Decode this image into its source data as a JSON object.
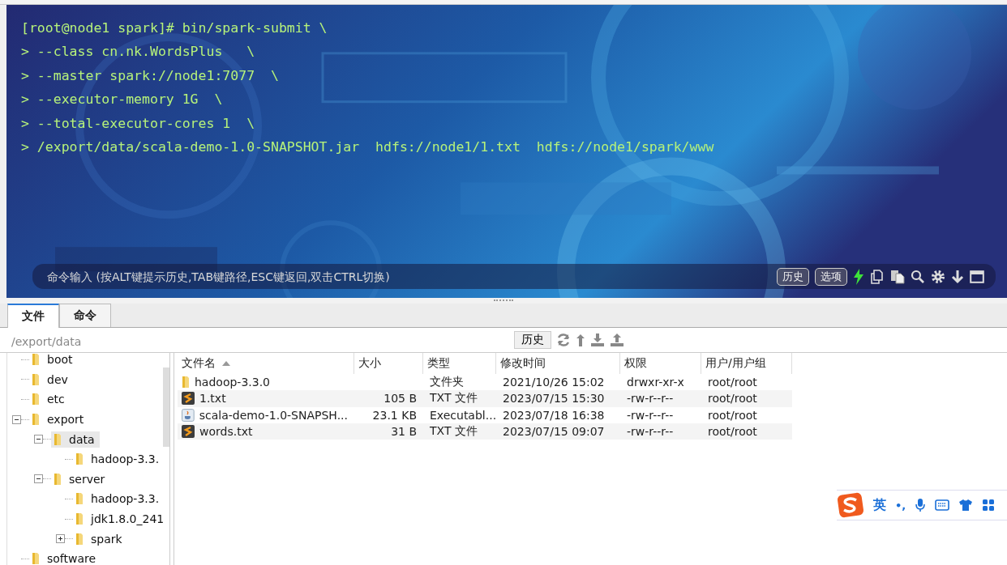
{
  "terminal": {
    "lines": [
      "[root@node1 spark]# bin/spark-submit \\",
      "> --class cn.nk.WordsPlus   \\",
      "> --master spark://node1:7077  \\",
      "> --executor-memory 1G  \\",
      "> --total-executor-cores 1  \\",
      "> /export/data/scala-demo-1.0-SNAPSHOT.jar  hdfs://node1/1.txt  hdfs://node1/spark/www"
    ],
    "command_input": {
      "placeholder": "命令输入 (按ALT键提示历史,TAB键路径,ESC键返回,双击CTRL切换)"
    },
    "buttons": [
      "历史",
      "选项"
    ]
  },
  "tabs": [
    {
      "label": "文件",
      "selected": true
    },
    {
      "label": "命令",
      "selected": false
    }
  ],
  "path_bar": {
    "path": "/export/data",
    "history_button": "历史"
  },
  "tree": [
    {
      "name": "boot",
      "selected": false
    },
    {
      "name": "dev",
      "selected": false
    },
    {
      "name": "etc",
      "selected": false
    },
    {
      "name": "export",
      "selected": false,
      "expanded": true,
      "children": [
        {
          "name": "data",
          "selected": true,
          "expanded": true,
          "children": [
            {
              "name": "hadoop-3.3.",
              "selected": false
            }
          ]
        },
        {
          "name": "server",
          "selected": false,
          "expanded": true,
          "children": [
            {
              "name": "hadoop-3.3.",
              "selected": false
            },
            {
              "name": "jdk1.8.0_241",
              "selected": false
            },
            {
              "name": "spark",
              "selected": false,
              "expanded": false
            }
          ]
        }
      ]
    },
    {
      "name": "software",
      "selected": false
    }
  ],
  "file_table": {
    "columns": [
      {
        "label": "文件名",
        "sorted": true
      },
      {
        "label": "大小",
        "sorted": false
      },
      {
        "label": "类型",
        "sorted": false
      },
      {
        "label": "修改时间",
        "sorted": false
      },
      {
        "label": "权限",
        "sorted": false
      },
      {
        "label": "用户/用户组",
        "sorted": false
      }
    ],
    "rows": [
      {
        "kind": "folder",
        "name": "hadoop-3.3.0",
        "type": "文件夹",
        "modified": "2021/10/26 15:02",
        "permissions": "drwxr-xr-x",
        "owner": "root/root"
      },
      {
        "kind": "text",
        "name": "1.txt",
        "size": "105 B",
        "type": "TXT 文件",
        "modified": "2023/07/15 15:30",
        "permissions": "-rw-r--r--",
        "owner": "root/root"
      },
      {
        "kind": "jar",
        "name": "scala-demo-1.0-SNAPSH...",
        "size": "23.1 KB",
        "type": "Executabl...",
        "modified": "2023/07/18 16:38",
        "permissions": "-rw-r--r--",
        "owner": "root/root"
      },
      {
        "kind": "text",
        "name": "words.txt",
        "size": "31 B",
        "type": "TXT 文件",
        "modified": "2023/07/15 09:07",
        "permissions": "-rw-r--r--",
        "owner": "root/root"
      }
    ]
  },
  "ime_toolbar": {
    "language": "英",
    "punctuation": "•,"
  }
}
